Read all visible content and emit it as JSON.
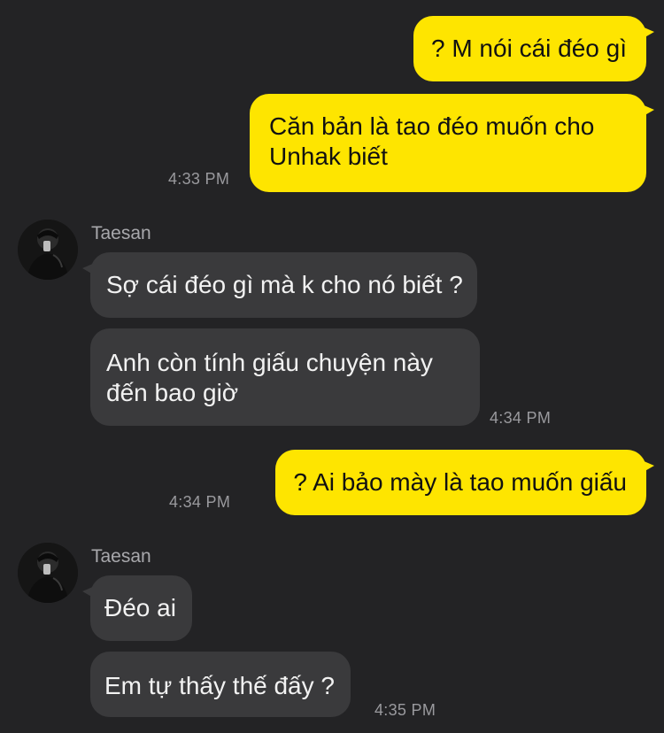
{
  "messages": [
    {
      "dir": "out",
      "text": "? M nói cái đéo gì"
    },
    {
      "dir": "out",
      "lines": [
        "Căn bản là tao đéo muốn cho",
        "Unhak biết"
      ],
      "time": "4:33 PM"
    },
    {
      "dir": "in",
      "sender": "Taesan",
      "text": "Sợ cái đéo gì mà k cho nó biết ?"
    },
    {
      "dir": "in",
      "lines": [
        "Anh còn tính giấu chuyện này",
        "đến bao giờ"
      ],
      "time": "4:34 PM"
    },
    {
      "dir": "out",
      "text": "? Ai bảo mày là tao muốn giấu",
      "time": "4:34 PM"
    },
    {
      "dir": "in",
      "sender": "Taesan",
      "text": "Đéo ai"
    },
    {
      "dir": "in",
      "text": "Em tự thấy thế đấy ?",
      "time": "4:35 PM"
    }
  ],
  "avatar_icon": "person-avatar-icon",
  "colors": {
    "background": "#232325",
    "outgoing_bubble": "#FEE500",
    "incoming_bubble": "#3A3A3C",
    "timestamp": "#9A9A9E"
  }
}
